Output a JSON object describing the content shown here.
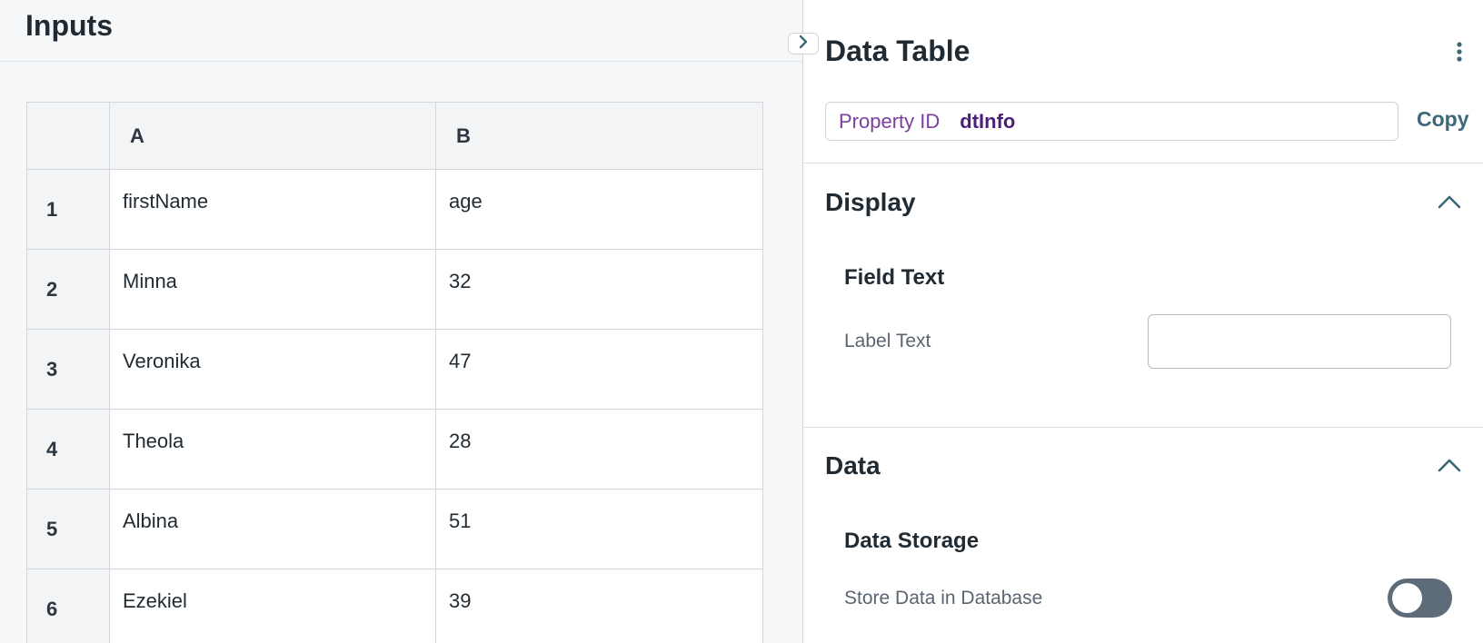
{
  "canvas": {
    "title": "Inputs",
    "grid": {
      "columns": [
        "A",
        "B"
      ],
      "rows": [
        {
          "num": "1",
          "cells": [
            "firstName",
            "age"
          ]
        },
        {
          "num": "2",
          "cells": [
            "Minna",
            "32"
          ]
        },
        {
          "num": "3",
          "cells": [
            "Veronika",
            "47"
          ]
        },
        {
          "num": "4",
          "cells": [
            "Theola",
            "28"
          ]
        },
        {
          "num": "5",
          "cells": [
            "Albina",
            "51"
          ]
        },
        {
          "num": "6",
          "cells": [
            "Ezekiel",
            "39"
          ]
        }
      ]
    }
  },
  "panel": {
    "title": "Data Table",
    "more_icon": "vertical-dots-icon",
    "property": {
      "label": "Property ID",
      "value": "dtInfo",
      "copy_label": "Copy"
    },
    "display": {
      "title": "Display",
      "subsection": "Field Text",
      "label_text": {
        "label": "Label Text",
        "value": "",
        "placeholder": ""
      }
    },
    "data": {
      "title": "Data",
      "subsection": "Data Storage",
      "store_label": "Store Data in Database",
      "store_enabled": false
    }
  },
  "colors": {
    "accent": "#3d6878",
    "purple_label": "#7b3fa0",
    "purple_value": "#4b1f7a",
    "toggle_off": "#5e6b78"
  }
}
